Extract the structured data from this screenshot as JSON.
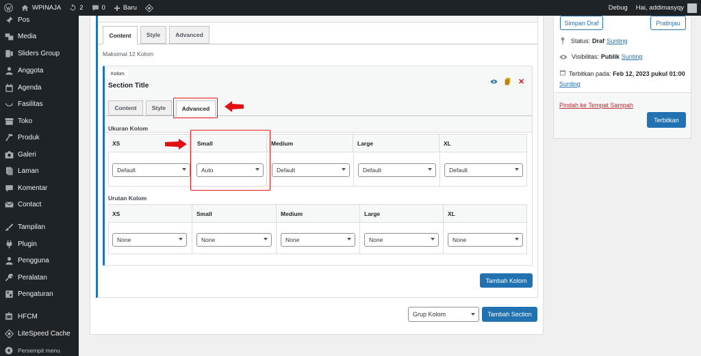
{
  "adminbar": {
    "site_name": "WPINAJA",
    "updates_count": "2",
    "comments_count": "0",
    "new_label": "Baru",
    "debug_label": "Debug",
    "greeting": "Hai, addimasyqy"
  },
  "sidebar": {
    "items": [
      {
        "label": "Pos",
        "icon": "pin-icon"
      },
      {
        "label": "Media",
        "icon": "media-icon"
      },
      {
        "label": "Sliders Group",
        "icon": "slides-icon"
      },
      {
        "label": "Anggota",
        "icon": "user-icon"
      },
      {
        "label": "Agenda",
        "icon": "calendar-icon"
      },
      {
        "label": "Fasilitas",
        "icon": "smile-icon"
      },
      {
        "label": "Toko",
        "icon": "store-icon"
      },
      {
        "label": "Produk",
        "icon": "hammer-icon"
      },
      {
        "label": "Galeri",
        "icon": "camera-icon"
      },
      {
        "label": "Laman",
        "icon": "page-icon"
      },
      {
        "label": "Komentar",
        "icon": "comment-icon"
      },
      {
        "label": "Contact",
        "icon": "mail-icon"
      },
      {
        "label": "Tampilan",
        "icon": "brush-icon"
      },
      {
        "label": "Plugin",
        "icon": "plugin-icon"
      },
      {
        "label": "Pengguna",
        "icon": "users-icon"
      },
      {
        "label": "Peralatan",
        "icon": "wrench-icon"
      },
      {
        "label": "Pengaturan",
        "icon": "settings-icon"
      },
      {
        "label": "HFCM",
        "icon": "robot-icon"
      },
      {
        "label": "LiteSpeed Cache",
        "icon": "diamond-icon"
      },
      {
        "label": "Persempit menu",
        "icon": "collapse-icon"
      }
    ]
  },
  "editor": {
    "top_tabs": [
      "Content",
      "Style",
      "Advanced"
    ],
    "max_cols_text": "Maksimal 12 Kolom",
    "section": {
      "badge": "Kolom",
      "title": "Section Title",
      "tabs": [
        "Content",
        "Style",
        "Advanced"
      ],
      "ukuran_label": "Ukuran Kolom",
      "ukuran_headers": [
        "XS",
        "Small",
        "Medium",
        "Large",
        "XL"
      ],
      "ukuran_values": [
        "Default",
        "Auto",
        "Default",
        "Default",
        "Default"
      ],
      "urutan_label": "Urutan Kolom",
      "urutan_headers": [
        "XS",
        "Small",
        "Medium",
        "Large",
        "XL"
      ],
      "urutan_values": [
        "None",
        "None",
        "None",
        "None",
        "None"
      ]
    },
    "tambah_kolom": "Tambah Kolom",
    "grup_select": "Grup Kolom",
    "tambah_section": "Tambah Section"
  },
  "publish": {
    "save_draft": "Simpan Draf",
    "preview": "Pratinjau",
    "status_label": "Status:",
    "status_value": "Draf",
    "visibility_label": "Visibilitas:",
    "visibility_value": "Publik",
    "publish_on_label": "Terbitkan pada:",
    "publish_on_value": "Feb 12, 2023 pukul 01:00",
    "edit_link": "Sunting",
    "trash": "Pindah ke Tempat Sampah",
    "publish_button": "Terbitkan"
  },
  "colors": {
    "accent": "#2271b1",
    "admin_dark": "#1d2327",
    "annotation": "#e11111",
    "delete": "#cc1818"
  }
}
